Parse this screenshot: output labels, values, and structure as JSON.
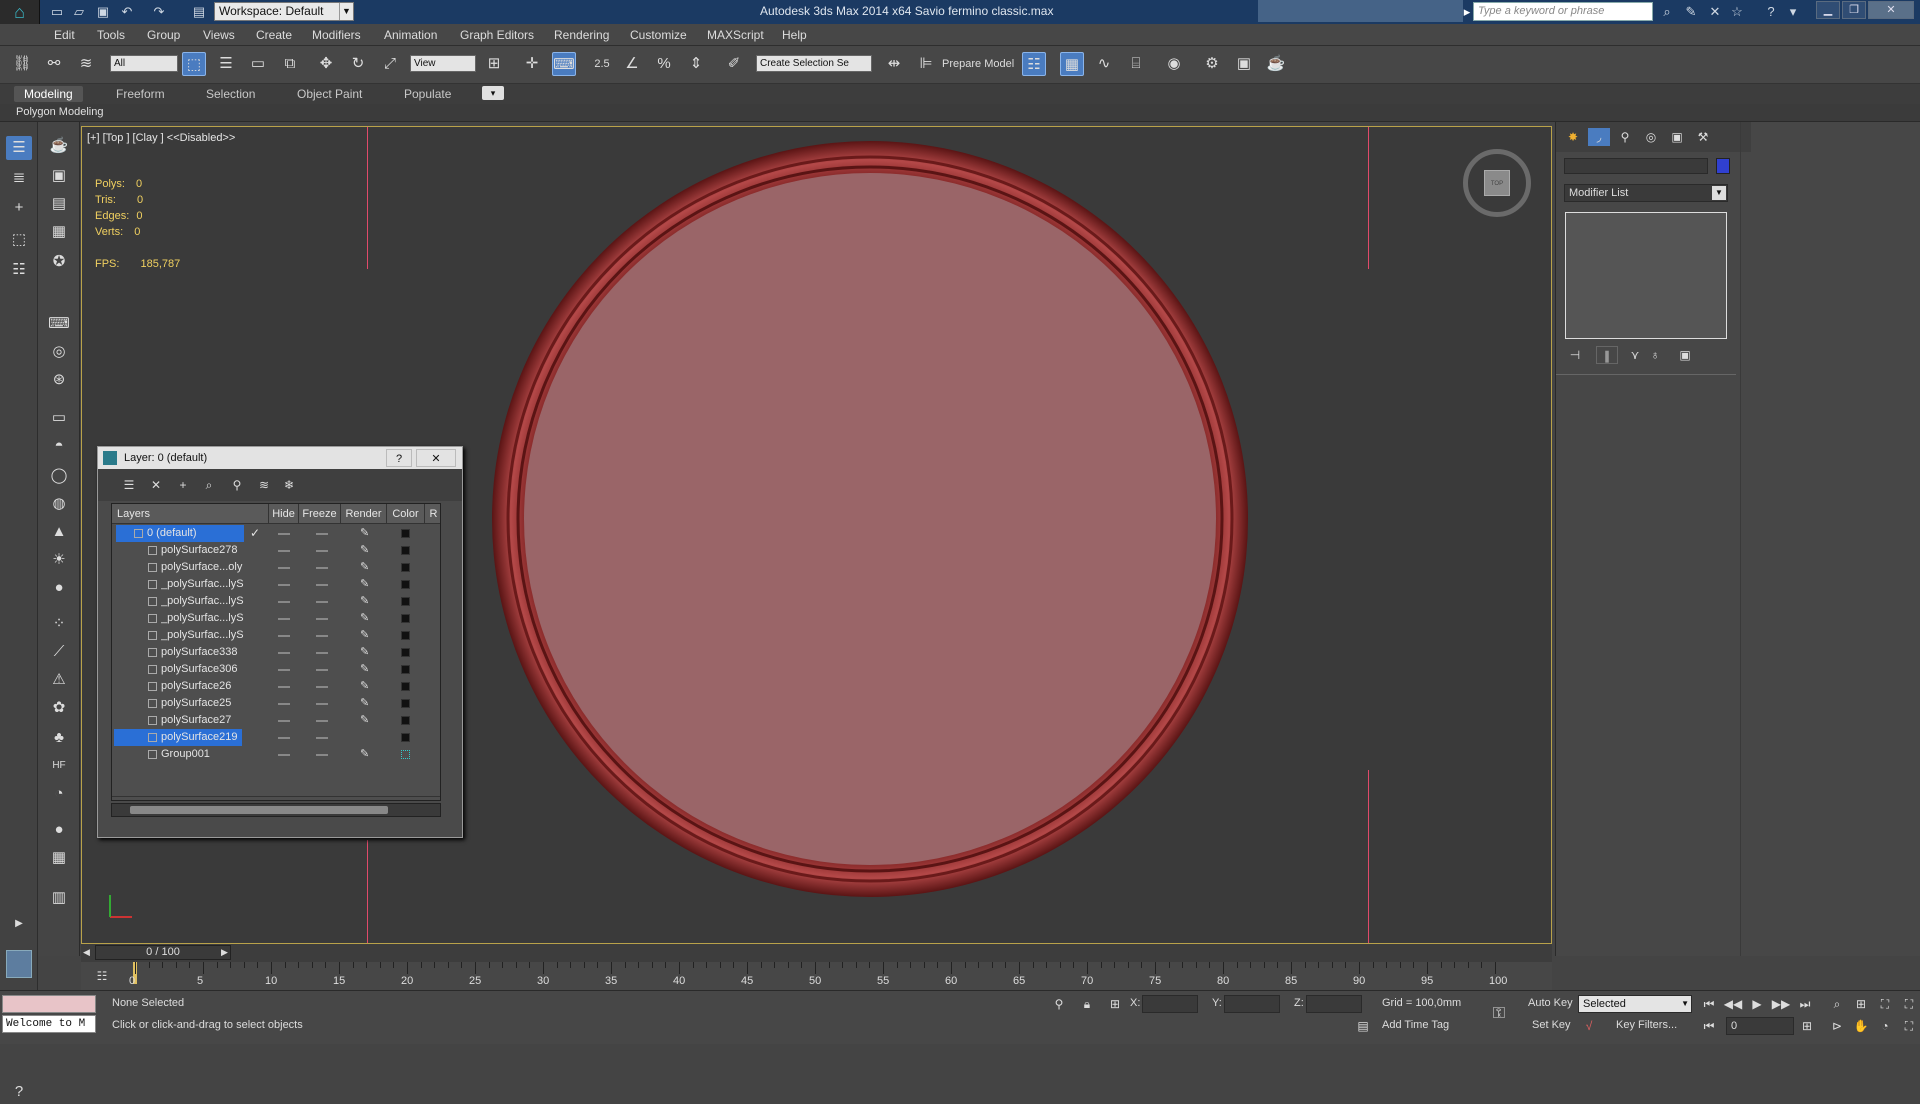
{
  "titlebar": {
    "workspace": "Workspace: Default",
    "title": "Autodesk 3ds Max  2014 x64     Savio fermino classic.max",
    "search_placeholder": "Type a keyword or phrase"
  },
  "menu": [
    "Edit",
    "Tools",
    "Group",
    "Views",
    "Create",
    "Modifiers",
    "Animation",
    "Graph Editors",
    "Rendering",
    "Customize",
    "MAXScript",
    "Help"
  ],
  "toolbar": {
    "filter_select": "All",
    "view_select": "View",
    "snap_label": "2.5",
    "selection_set_placeholder": "Create Selection Se",
    "prepare_model": "Prepare Model"
  },
  "ribbon": {
    "tabs": [
      "Modeling",
      "Freeform",
      "Selection",
      "Object Paint",
      "Populate"
    ],
    "active": "Modeling",
    "sub_label": "Polygon Modeling"
  },
  "viewport": {
    "label": "[+] [Top ] [Clay ]  <<Disabled>>",
    "stats": [
      {
        "label": "Polys:",
        "value": "0"
      },
      {
        "label": "Tris:",
        "value": "0"
      },
      {
        "label": "Edges:",
        "value": "0"
      },
      {
        "label": "Verts:",
        "value": "0"
      }
    ],
    "fps_label": "FPS:",
    "fps_value": "185,787",
    "viewcube": "TOP"
  },
  "layer_dialog": {
    "title": "Layer: 0 (default)",
    "help": "?",
    "close": "✕",
    "columns": [
      "Layers",
      "Hide",
      "Freeze",
      "Render",
      "Color",
      "R"
    ],
    "rows": [
      {
        "name": "0 (default)",
        "selected": true,
        "check": "✓"
      },
      {
        "name": "polySurface278"
      },
      {
        "name": "polySurface...oly"
      },
      {
        "name": "_polySurfac...lyS"
      },
      {
        "name": "_polySurfac...lyS"
      },
      {
        "name": "_polySurfac...lyS"
      },
      {
        "name": "_polySurfac...lyS"
      },
      {
        "name": "polySurface338"
      },
      {
        "name": "polySurface306"
      },
      {
        "name": "polySurface26"
      },
      {
        "name": "polySurface25"
      },
      {
        "name": "polySurface27"
      },
      {
        "name": "polySurface219",
        "selected": true
      },
      {
        "name": "Group001"
      }
    ]
  },
  "right_panel": {
    "modifier_list": "Modifier List"
  },
  "timeline": {
    "frame": "0 / 100",
    "ticks": [
      "0",
      "5",
      "10",
      "15",
      "20",
      "25",
      "30",
      "35",
      "40",
      "45",
      "50",
      "55",
      "60",
      "65",
      "70",
      "75",
      "80",
      "85",
      "90",
      "95",
      "100"
    ]
  },
  "status": {
    "maxscript": "Welcome to M",
    "selection": "None Selected",
    "prompt": "Click or click-and-drag to select objects",
    "x_label": "X:",
    "y_label": "Y:",
    "z_label": "Z:",
    "grid": "Grid = 100,0mm",
    "add_time_tag": "Add Time Tag",
    "auto_key": "Auto Key",
    "set_key": "Set Key",
    "selected_select": "Selected",
    "key_filters": "Key Filters...",
    "frame_field": "0"
  },
  "colors": {
    "plate_fill": "#9a6568",
    "plate_rim": "#8a2b2b",
    "viewport_bg": "#3a3a3a",
    "selection_blue": "#2a6fd6",
    "guide_line": "#e04a6a",
    "stats_yellow": "#f0d060"
  }
}
